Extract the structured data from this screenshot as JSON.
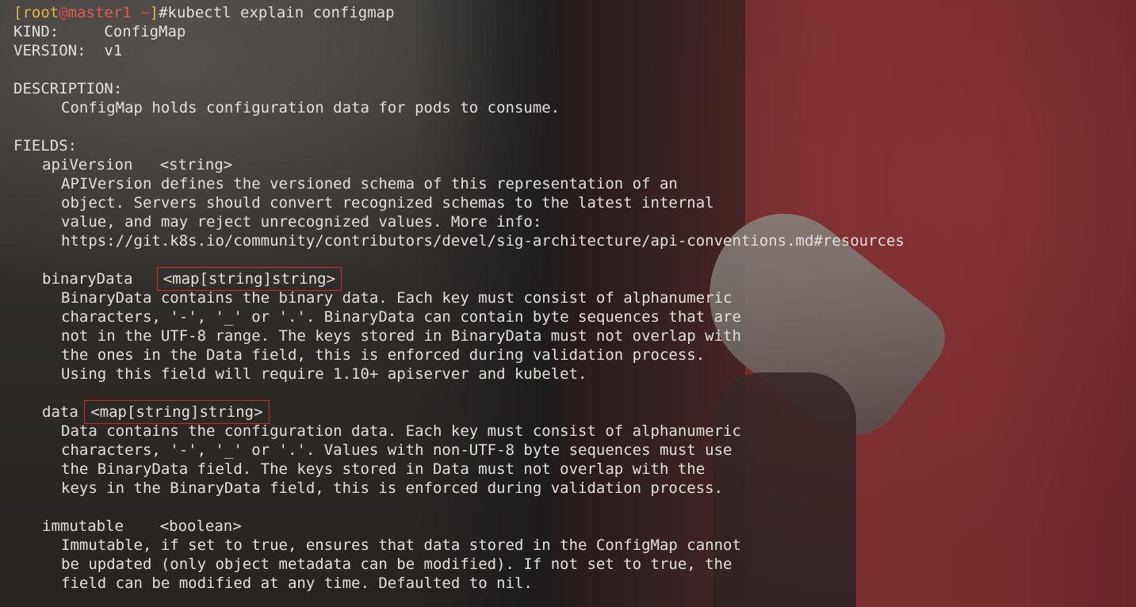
{
  "prompt": {
    "open_bracket": "[",
    "user": "root",
    "at": "@",
    "host": "master1",
    "path": " ~",
    "close_bracket": "]",
    "symbol": "#",
    "command": "kubectl explain configmap"
  },
  "header": {
    "kind_label": "KIND:",
    "kind_value": "ConfigMap",
    "version_label": "VERSION:",
    "version_value": "v1"
  },
  "description": {
    "label": "DESCRIPTION:",
    "text": "ConfigMap holds configuration data for pods to consume."
  },
  "fields_label": "FIELDS:",
  "fields": [
    {
      "name": "apiVersion",
      "type": "<string>",
      "lines": [
        "APIVersion defines the versioned schema of this representation of an",
        "object. Servers should convert recognized schemas to the latest internal",
        "value, and may reject unrecognized values. More info:",
        "https://git.k8s.io/community/contributors/devel/sig-architecture/api-conventions.md#resources"
      ]
    },
    {
      "name": "binaryData",
      "type": "<map[string]string>",
      "lines": [
        "BinaryData contains the binary data. Each key must consist of alphanumeric",
        "characters, '-', '_' or '.'. BinaryData can contain byte sequences that are",
        "not in the UTF-8 range. The keys stored in BinaryData must not overlap with",
        "the ones in the Data field, this is enforced during validation process.",
        "Using this field will require 1.10+ apiserver and kubelet."
      ]
    },
    {
      "name": "data",
      "type": "<map[string]string>",
      "lines": [
        "Data contains the configuration data. Each key must consist of alphanumeric",
        "characters, '-', '_' or '.'. Values with non-UTF-8 byte sequences must use",
        "the BinaryData field. The keys stored in Data must not overlap with the",
        "keys in the BinaryData field, this is enforced during validation process."
      ]
    },
    {
      "name": "immutable",
      "type": "<boolean>",
      "lines": [
        "Immutable, if set to true, ensures that data stored in the ConfigMap cannot",
        "be updated (only object metadata can be modified). If not set to true, the",
        "field can be modified at any time. Defaulted to nil."
      ]
    }
  ],
  "colors": {
    "text": "#e3e0dc",
    "prompt_bracket": "#d8bb3c",
    "prompt_user": "#e7b43c",
    "prompt_host": "#dc5b4b",
    "highlight_box": "#d2262a"
  }
}
